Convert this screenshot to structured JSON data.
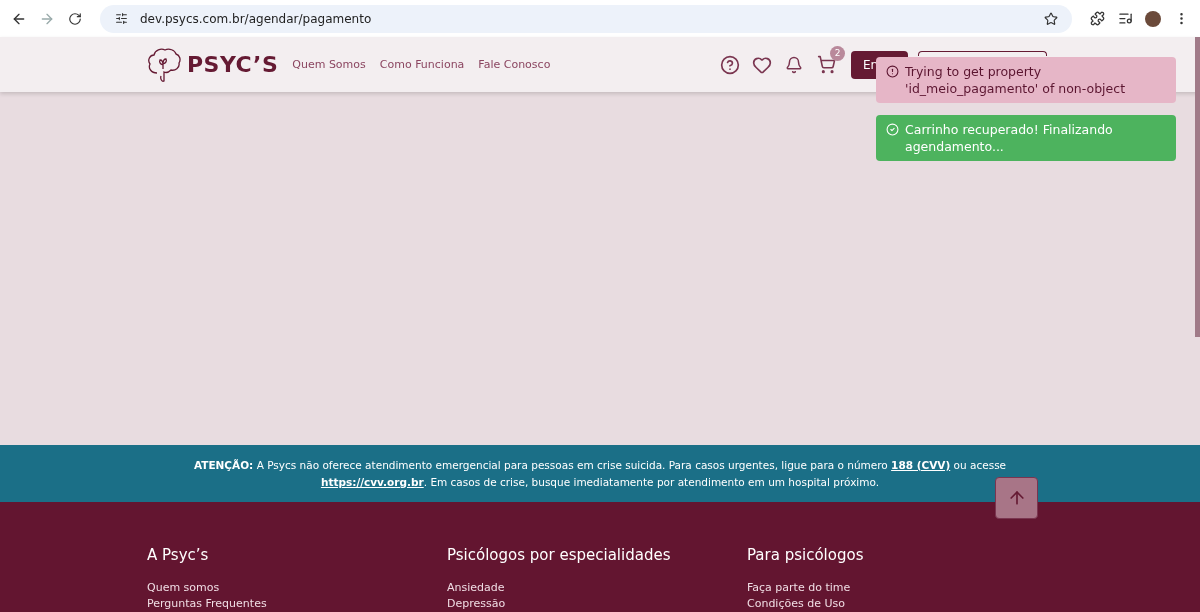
{
  "browser": {
    "url": "dev.psycs.com.br/agendar/pagamento"
  },
  "header": {
    "logo": "PSYC’S",
    "nav": [
      "Quem Somos",
      "Como Funciona",
      "Fale Conosco"
    ],
    "cart_count": "2",
    "login_button": "En"
  },
  "toasts": [
    {
      "kind": "error",
      "message": "Trying to get property 'id_meio_pagamento' of non-object"
    },
    {
      "kind": "success",
      "message": "Carrinho recuperado! Finalizando agendamento..."
    }
  ],
  "notice": {
    "before": "**ATENÇÃO:** A Psycs não oferece atendimento emergencial para pessoas em crise suicida. Para casos urgentes, ligue para o número",
    "phone_link": "188 (CVV)",
    "middle": "ou acesse",
    "site_link": "https://cvv.org.br",
    "after": ". Em casos de crise, busque imediatamente por atendimento em um hospital próximo."
  },
  "footer": {
    "columns": [
      {
        "title": "A Psyc’s",
        "links": [
          "Quem somos",
          "Perguntas Frequentes"
        ]
      },
      {
        "title": "Psicólogos por especialidades",
        "links": [
          "Ansiedade",
          "Depressão"
        ]
      },
      {
        "title": "Para psicólogos",
        "links": [
          "Faça parte do time",
          "Condições de Uso"
        ]
      }
    ]
  }
}
